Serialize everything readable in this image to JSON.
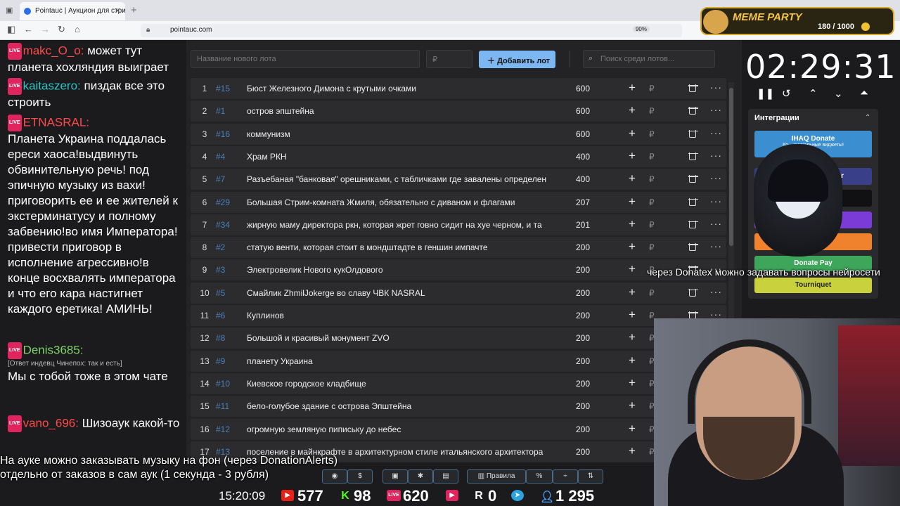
{
  "browser": {
    "tab_title": "Pointauc | Аукцион для стримеров",
    "url": "pointauc.com",
    "zoom": "90%"
  },
  "overlay": {
    "meme_title": "MEME PARTY",
    "meme_count": "180 / 1000"
  },
  "chat": [
    {
      "nick": "makc_O_o:",
      "nick_color": "#ff4a4a",
      "text": "может тут планета хохляндия выиграет"
    },
    {
      "nick": "kaitaszero:",
      "nick_color": "#2ec4c4",
      "text": "пиздак все это строить"
    },
    {
      "nick": "ETNASRAL:",
      "nick_color": "#ff4a4a",
      "text": "Планета Украина поддалась ереси хаоса!выдвинуть обвинительную речь! под эпичную музыку из вахи! приговорить ее и ее жителей к экстерминатусу и полному забвению!во имя Императора! привести приговор в исполнение агрессивно!в конце восхвалять императора и что его кара настигнет каждого еретика! АМИНЬ!"
    },
    {
      "nick": "Denis3685:",
      "nick_color": "#7fd36b",
      "reply": "[Ответ индевц Чинепох: так и есть]",
      "text": "Мы с тобой тоже в этом чате"
    },
    {
      "nick": "vano_696:",
      "nick_color": "#ff4a4a",
      "text": "Шизоаук какой-то"
    }
  ],
  "auction": {
    "new_lot_placeholder": "Название нового лота",
    "amount_placeholder": "₽",
    "add_button": "Добавить лот",
    "search_placeholder": "Поиск среди лотов...",
    "lots": [
      {
        "n": "1",
        "id": "#15",
        "name": "Бюст Железного Димона с крутыми очками",
        "amount": "600"
      },
      {
        "n": "2",
        "id": "#1",
        "name": "остров эпштейна",
        "amount": "600"
      },
      {
        "n": "3",
        "id": "#16",
        "name": "коммунизм",
        "amount": "600"
      },
      {
        "n": "4",
        "id": "#4",
        "name": "Храм РКН",
        "amount": "400"
      },
      {
        "n": "5",
        "id": "#7",
        "name": "Разъебаная \"банковая\" орешниками, с табличками где завалены определен",
        "amount": "400"
      },
      {
        "n": "6",
        "id": "#29",
        "name": "Большая Стрим-комната Жмиля, обязательно с диваном и флагами",
        "amount": "207"
      },
      {
        "n": "7",
        "id": "#34",
        "name": "жирную маму директора ркн, которая жрет говно сидит на хуе черном, и та",
        "amount": "201"
      },
      {
        "n": "8",
        "id": "#2",
        "name": "статую венти, которая стоит в мондштадте в геншин импачте",
        "amount": "200"
      },
      {
        "n": "9",
        "id": "#3",
        "name": "Электровелик Нового кукОлдового",
        "amount": "200"
      },
      {
        "n": "10",
        "id": "#5",
        "name": "Смайлик ZhmilJokerge во славу ЧВК NASRAL",
        "amount": "200"
      },
      {
        "n": "11",
        "id": "#6",
        "name": "Куплинов",
        "amount": "200"
      },
      {
        "n": "12",
        "id": "#8",
        "name": "Большой и красивый монумент ZVO",
        "amount": "200"
      },
      {
        "n": "13",
        "id": "#9",
        "name": "планету Украина",
        "amount": "200"
      },
      {
        "n": "14",
        "id": "#10",
        "name": "Киевское городское кладбище",
        "amount": "200"
      },
      {
        "n": "15",
        "id": "#11",
        "name": "бело-голубое здание с острова Эпштейна",
        "amount": "200"
      },
      {
        "n": "16",
        "id": "#12",
        "name": "огромную земляную пипиську до небес",
        "amount": "200"
      },
      {
        "n": "17",
        "id": "#13",
        "name": "поселение в майнкрафте в архитектурном стиле итальянского архитектора",
        "amount": "200"
      }
    ],
    "currency": "₽"
  },
  "timer": "02:29:31",
  "integrations": {
    "title": "Интеграции",
    "buttons": [
      {
        "label": "IHAQ Donate",
        "sub": "Ко... уникальные виджеты!",
        "color": "#3b8fd1"
      },
      {
        "label": "er",
        "color": "#3a3f8a"
      },
      {
        "label": "",
        "color": "#111114"
      },
      {
        "label": "",
        "color": "#7a3bd6"
      },
      {
        "label": "Alerts",
        "color": "#f0822d"
      },
      {
        "label": "Donate Pay",
        "color": "#3ea65a"
      },
      {
        "label": "Tourniquet",
        "color": "#c9d13d"
      }
    ]
  },
  "subtitles": {
    "line1": "На ауке можно заказывать музыку на фон (через DonationAlerts)",
    "line2": "отдельно от заказов в сам аук (1 секунда - 3 рубля)",
    "right": "через Donatex можно задавать вопросы нейросети"
  },
  "toolbar_bottom": {
    "rules": "Правила"
  },
  "stats": {
    "clock": "15:20:09",
    "youtube": "577",
    "kick": "98",
    "live": "620",
    "vk": "0",
    "rutube": "0",
    "viewers": "1 295"
  }
}
